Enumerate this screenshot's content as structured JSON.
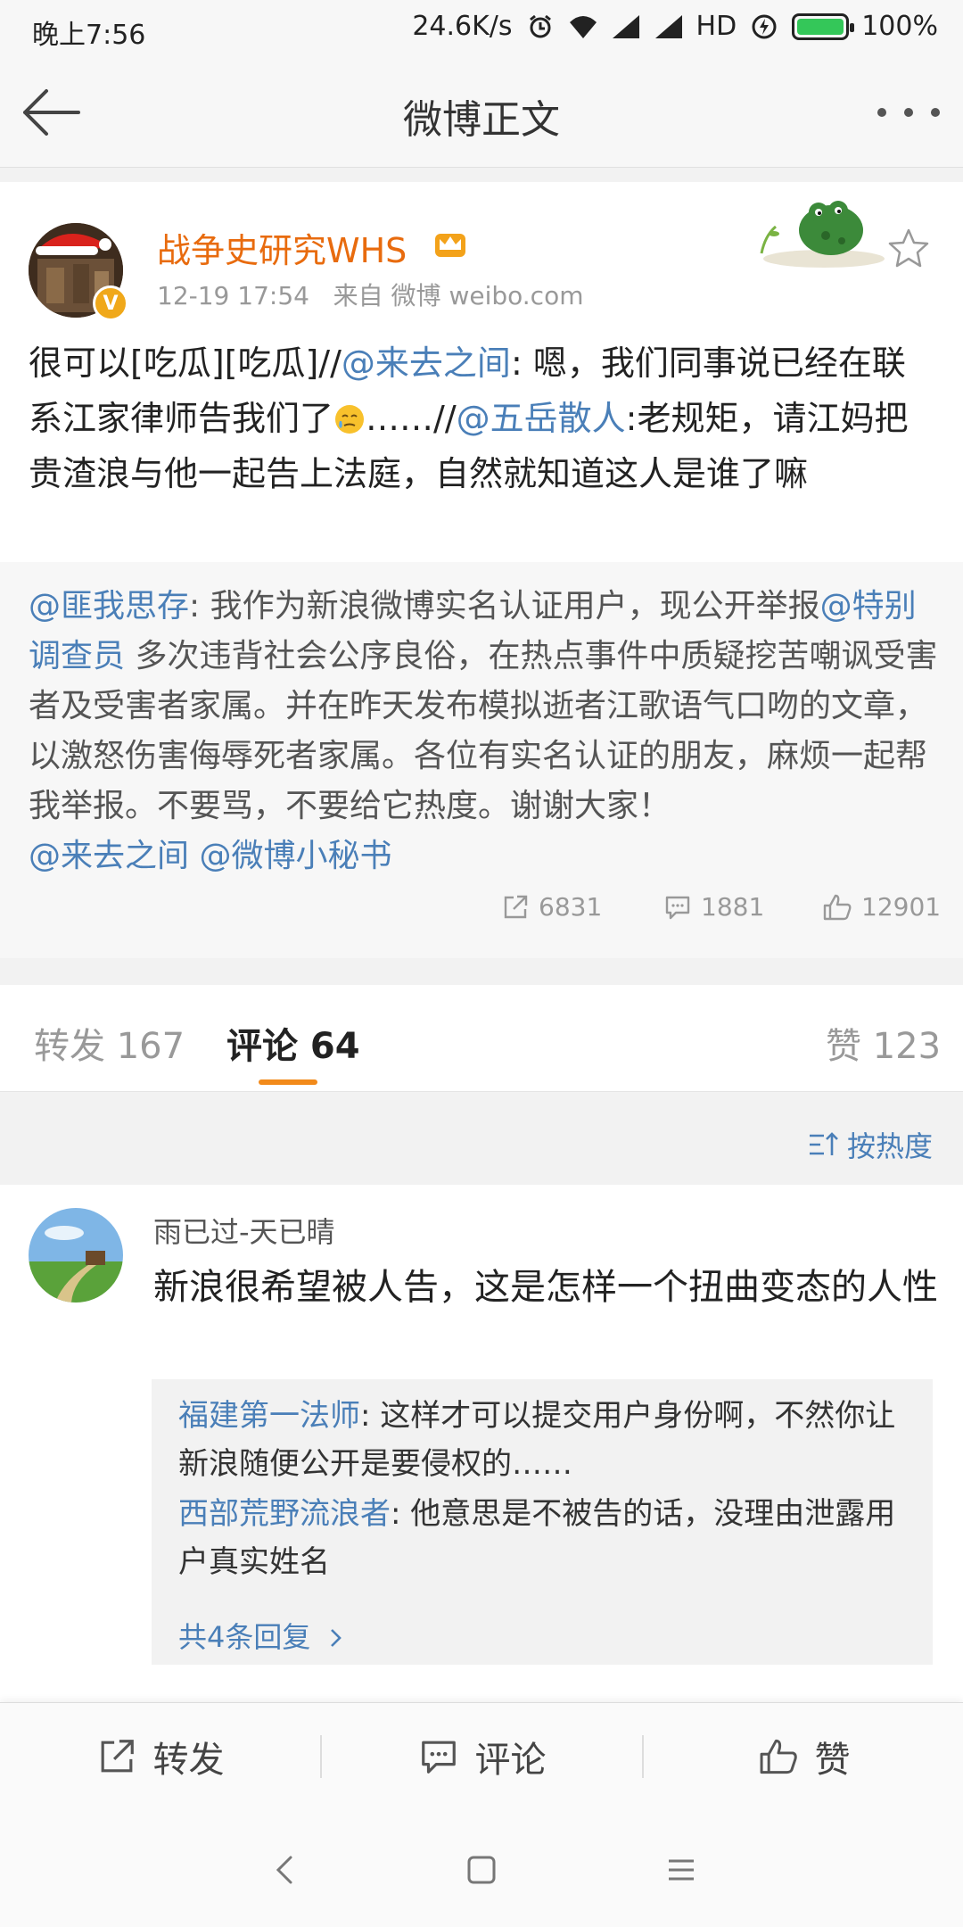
{
  "status_bar": {
    "time": "晚上7:56",
    "net_speed": "24.6K/s",
    "network_type": "HD",
    "battery_pct": "100%"
  },
  "header": {
    "title": "微博正文"
  },
  "post": {
    "author": "战争史研究WHS",
    "verified_badge": "V",
    "date": "12-19 17:54",
    "source": "来自 微博 weibo.com",
    "text": {
      "t1": "很可以[吃瓜][吃瓜]//",
      "at1": "@来去之间",
      "t2": ": 嗯，我们同事说已经在联系江家律师告我们了",
      "t3": "……//",
      "at2": "@五岳散人",
      "t4": ":老规矩，请江妈把贵渣浪与他一起告上法庭，自然就知道这人是谁了嘛"
    },
    "quote": {
      "at1": "@匪我思存",
      "t1": ": 我作为新浪微博实名认证用户，现公开举报",
      "at2": "@特别调查员",
      "t2": " 多次违背社会公序良俗，在热点事件中质疑挖苦嘲讽受害者及受害者家属。并在昨天发布模拟逝者江歌语气口吻的文章，以激怒伤害侮辱死者家属。各位有实名认证的朋友，麻烦一起帮我举报。不要骂，不要给它热度。谢谢大家！",
      "at3": "@来去之间",
      "at4": "@微博小秘书"
    },
    "repost_count": "6831",
    "comment_count": "1881",
    "like_count": "12901"
  },
  "tabs": {
    "repost": "转发 167",
    "comment": "评论 64",
    "like": "赞 123"
  },
  "sort_label": "按热度",
  "comment": {
    "user": "雨已过-天已晴",
    "text": "新浪很希望被人告，这是怎样一个扭曲变态的人性",
    "replies": [
      {
        "user": "福建第一法师",
        "text": ": 这样才可以提交用户身份啊，不然你让新浪随便公开是要侵权的……"
      },
      {
        "user": "西部荒野流浪者",
        "text": ": 他意思是不被告的话，没理由泄露用户真实姓名"
      }
    ],
    "more_replies": "共4条回复"
  },
  "action_bar": {
    "repost": "转发",
    "comment": "评论",
    "like": "赞"
  },
  "colors": {
    "accent_orange": "#f28a1a",
    "author_orange": "#e86b0e",
    "link_blue": "#4a7fb8"
  }
}
